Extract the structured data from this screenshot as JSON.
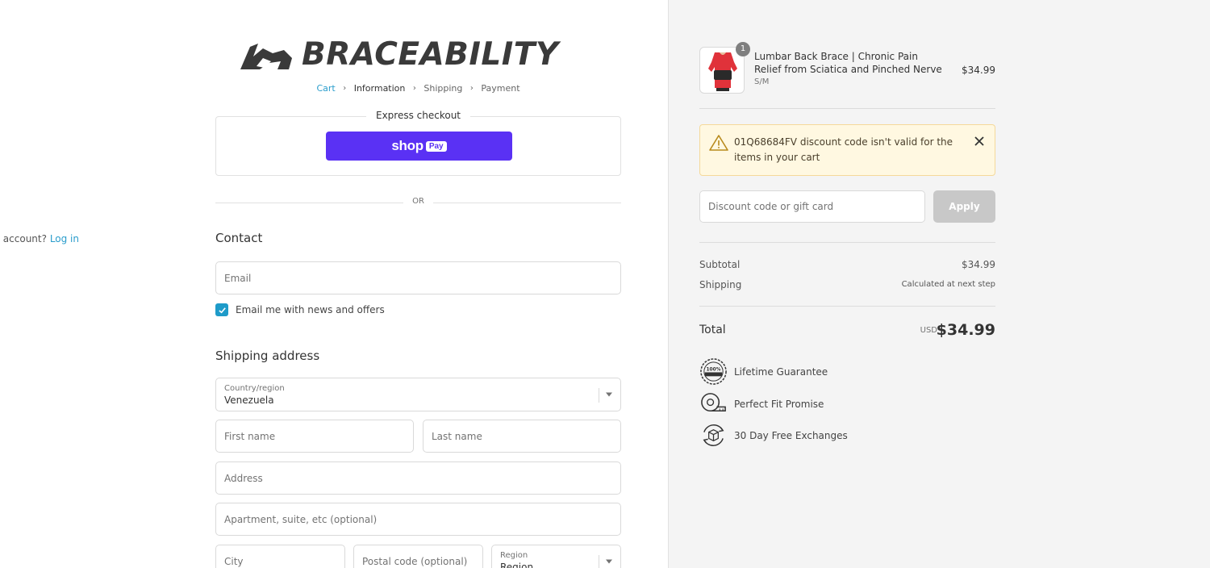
{
  "brand": {
    "name": "BRACEABILITY"
  },
  "breadcrumb": {
    "cart": "Cart",
    "information": "Information",
    "shipping": "Shipping",
    "payment": "Payment"
  },
  "express": {
    "label": "Express checkout",
    "shoppay_text": "shop",
    "shoppay_pay": "Pay"
  },
  "or_label": "OR",
  "contact": {
    "title": "Contact",
    "have_account": "Have an account?",
    "login": "Log in",
    "email_placeholder": "Email",
    "newsletter_label": "Email me with news and offers",
    "newsletter_checked": true
  },
  "shipping_address": {
    "title": "Shipping address",
    "country_label": "Country/region",
    "country_value": "Venezuela",
    "first_name_placeholder": "First name",
    "last_name_placeholder": "Last name",
    "address_placeholder": "Address",
    "apartment_placeholder": "Apartment, suite, etc (optional)",
    "city_placeholder": "City",
    "postal_placeholder": "Postal code (optional)",
    "region_label": "Region",
    "region_value": "Region"
  },
  "cart": {
    "item": {
      "title": "Lumbar Back Brace | Chronic Pain Relief from Sciatica and Pinched Nerve",
      "variant": "S/M",
      "price": "$34.99",
      "quantity": "1"
    },
    "alert": {
      "code": "01Q68684FV",
      "message": "discount code isn't valid for the items in your cart"
    },
    "discount_placeholder": "Discount code or gift card",
    "apply_label": "Apply",
    "subtotal_label": "Subtotal",
    "subtotal_value": "$34.99",
    "shipping_label": "Shipping",
    "shipping_value": "Calculated at next step",
    "total_label": "Total",
    "currency": "USD",
    "total_value": "$34.99"
  },
  "guarantees": [
    {
      "icon": "guarantee-seal-icon",
      "label": "Lifetime Guarantee"
    },
    {
      "icon": "measuring-tape-icon",
      "label": "Perfect Fit Promise"
    },
    {
      "icon": "exchange-box-icon",
      "label": "30 Day Free Exchanges"
    }
  ],
  "colors": {
    "link": "#2a9dcc",
    "shoppay": "#5a31f4",
    "checkbox": "#1e9bc9",
    "alert_bg": "#fff8e1",
    "sidebar_bg": "#f4f4f4"
  }
}
